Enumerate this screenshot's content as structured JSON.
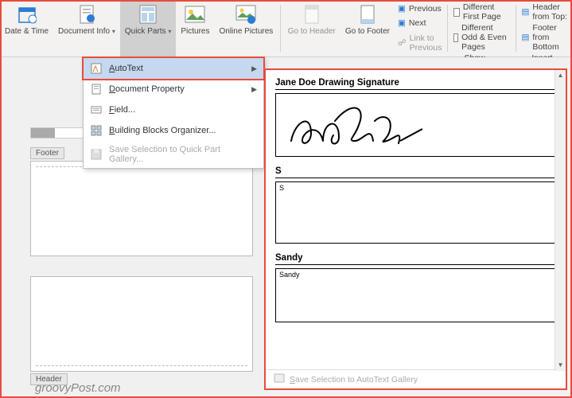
{
  "ribbon": {
    "date_time": "Date &\nTime",
    "doc_info": "Document\nInfo",
    "quick_parts": "Quick\nParts",
    "pictures": "Pictures",
    "online_pics": "Online\nPictures",
    "goto_header": "Go to\nHeader",
    "goto_footer": "Go to\nFooter",
    "nav": {
      "previous": "Previous",
      "next": "Next",
      "link": "Link to Previous"
    },
    "opts": {
      "diff_first": "Different First Page",
      "diff_odd": "Different Odd & Even Pages",
      "show_text": "Show Document Text"
    },
    "pos": {
      "header_top": "Header from Top:",
      "footer_bottom": "Footer from Bottom",
      "align_tab": "Insert Alignment Tab"
    }
  },
  "menu": {
    "autotext": "AutoText",
    "doc_prop": "Document Property",
    "field": "Field...",
    "bb_org": "Building Blocks Organizer...",
    "save_qp": "Save Selection to Quick Part Gallery..."
  },
  "flyout": {
    "h1": "Jane Doe Drawing Signature",
    "h2": "S",
    "v2": "S",
    "h3": "Sandy",
    "v3": "Sandy",
    "save": "Save Selection to AutoText Gallery"
  },
  "page": {
    "footer": "Footer",
    "header": "Header"
  },
  "watermark": "groovyPost.com"
}
